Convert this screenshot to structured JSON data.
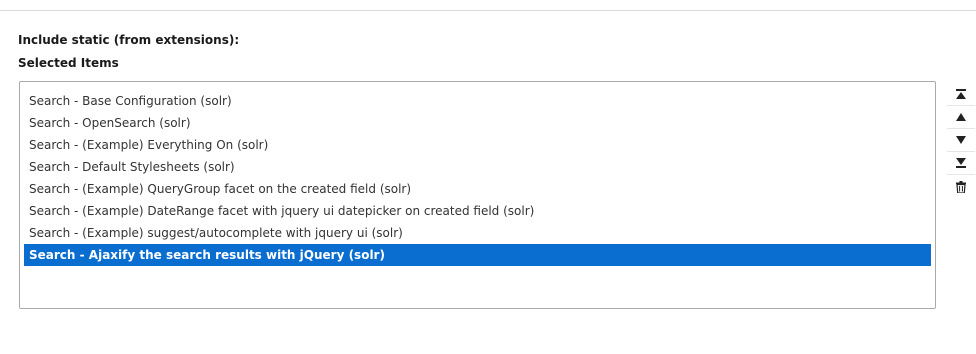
{
  "field": {
    "title": "Include static (from extensions):",
    "selected_label": "Selected Items"
  },
  "items": [
    {
      "label": "Search - Base Configuration (solr)",
      "selected": false
    },
    {
      "label": "Search - OpenSearch (solr)",
      "selected": false
    },
    {
      "label": "Search - (Example) Everything On (solr)",
      "selected": false
    },
    {
      "label": "Search - Default Stylesheets (solr)",
      "selected": false
    },
    {
      "label": "Search - (Example) QueryGroup facet on the created field (solr)",
      "selected": false
    },
    {
      "label": "Search - (Example) DateRange facet with jquery ui datepicker on created field (solr)",
      "selected": false
    },
    {
      "label": "Search - (Example) suggest/autocomplete with jquery ui (solr)",
      "selected": false
    },
    {
      "label": "Search - Ajaxify the search results with jQuery (solr)",
      "selected": true
    }
  ],
  "controls": [
    {
      "name": "move-to-top-button",
      "icon": "move-to-top-icon"
    },
    {
      "name": "move-up-button",
      "icon": "move-up-icon"
    },
    {
      "name": "move-down-button",
      "icon": "move-down-icon"
    },
    {
      "name": "move-to-bottom-button",
      "icon": "move-to-bottom-icon"
    },
    {
      "name": "remove-item-button",
      "icon": "trash-icon"
    }
  ],
  "colors": {
    "selection": "#0a6ed1",
    "selection_text": "#ffffff",
    "border": "#aaaaaa",
    "icon": "#222222"
  }
}
